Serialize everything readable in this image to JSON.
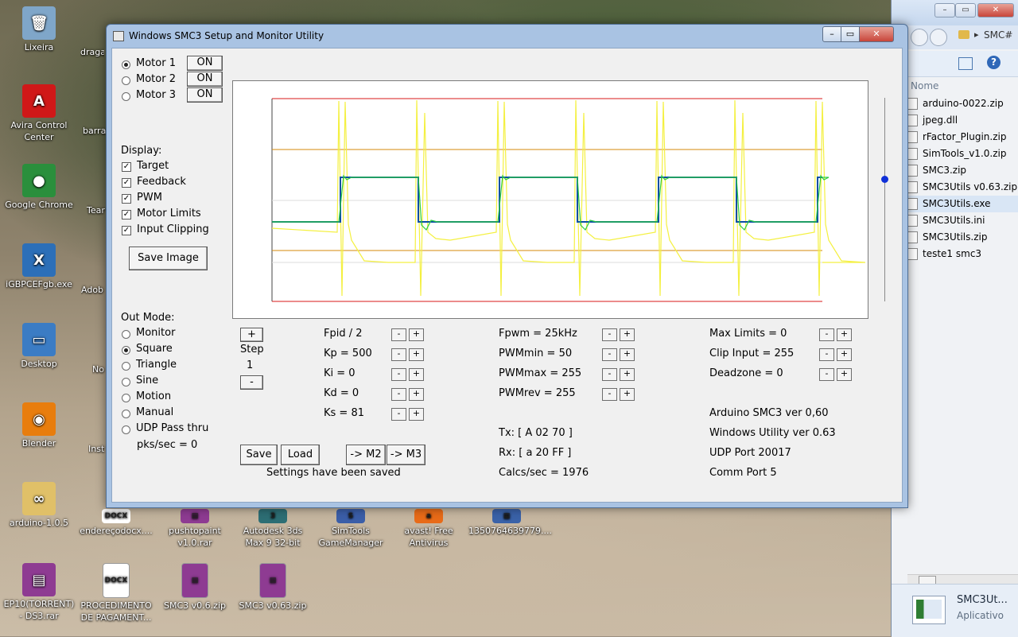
{
  "desktop": {
    "icons": [
      {
        "name": "recycle-bin-icon",
        "label": "Lixeira",
        "color": "#7fa6c9",
        "glyph": "🗑"
      },
      {
        "name": "avira-icon",
        "label": "Avira Control Center",
        "color": "#d01818",
        "glyph": "A"
      },
      {
        "name": "chrome-icon",
        "label": "Google Chrome",
        "color": "#2a8f3c",
        "glyph": "●"
      },
      {
        "name": "exe-icon",
        "label": "iGBPCEFgb.exe",
        "color": "#2c6fb8",
        "glyph": "X"
      },
      {
        "name": "desktop-shortcut-icon",
        "label": "Desktop",
        "color": "#3b7cc4",
        "glyph": "▭"
      },
      {
        "name": "blender-icon",
        "label": "Blender",
        "color": "#e87d0d",
        "glyph": "◉"
      },
      {
        "name": "arduino-folder-icon",
        "label": "arduino-1.0.5",
        "color": "#e0c068",
        "glyph": "∞"
      },
      {
        "name": "winrar-icon",
        "label": "EP10(TORRENT) - DS3.rar",
        "color": "#8e3b92",
        "glyph": "▤"
      }
    ],
    "partial_labels": [
      "draga",
      "barra",
      "Tear",
      "Adob",
      "No",
      "Inst Mo"
    ],
    "bottom_icons": [
      {
        "name": "docx-icon",
        "label": "endereçodocx....",
        "color": "#ffffff",
        "glyph": "DOCX"
      },
      {
        "name": "rar-icon",
        "label": "pushtopaint v1.0.rar",
        "color": "#8e3b92",
        "glyph": "▤"
      },
      {
        "name": "autodesk-icon",
        "label": "Autodesk 3ds Max 9 32-bit",
        "color": "#2d6e74",
        "glyph": "3"
      },
      {
        "name": "simtools-icon",
        "label": "SimTools GameManager",
        "color": "#3b5ea8",
        "glyph": "S"
      },
      {
        "name": "avast-icon",
        "label": "avast! Free Antivirus",
        "color": "#e86b18",
        "glyph": "a"
      },
      {
        "name": "image-icon",
        "label": "1350764639779....",
        "color": "#3a62a8",
        "glyph": "▦"
      }
    ],
    "row3_icons": [
      {
        "name": "docx2-icon",
        "label": "PROCEDIMENTO DE PAGAMENT...",
        "color": "#ffffff",
        "glyph": "DOCX"
      },
      {
        "name": "zip-smc3v06-icon",
        "label": "SMC3 v0.6.zip",
        "color": "#8e3b92",
        "glyph": "▤"
      },
      {
        "name": "zip-smc3v063-icon",
        "label": "SMC3 v0.63.zip",
        "color": "#8e3b92",
        "glyph": "▤"
      }
    ]
  },
  "explorer": {
    "breadcrumb": "SMC#",
    "column_header": "Nome",
    "files": [
      "arduino-0022.zip",
      "jpeg.dll",
      "rFactor_Plugin.zip",
      "SimTools_v1.0.zip",
      "SMC3.zip",
      "SMC3Utils v0.63.zip",
      "SMC3Utils.exe",
      "SMC3Utils.ini",
      "SMC3Utils.zip",
      "teste1 smc3"
    ],
    "selected_file": "SMC3Utils.exe",
    "details_name": "SMC3Ut...",
    "details_type": "Aplicativo"
  },
  "window": {
    "title": "Windows SMC3 Setup and Monitor Utility",
    "motors": [
      {
        "label": "Motor 1",
        "state": "ON",
        "selected": true
      },
      {
        "label": "Motor 2",
        "state": "ON",
        "selected": false
      },
      {
        "label": "Motor 3",
        "state": "ON",
        "selected": false
      }
    ],
    "display_label": "Display:",
    "display_options": [
      "Target",
      "Feedback",
      "PWM",
      "Motor Limits",
      "Input Clipping"
    ],
    "save_image": "Save Image",
    "out_mode_label": "Out Mode:",
    "out_modes": [
      "Monitor",
      "Square",
      "Triangle",
      "Sine",
      "Motion",
      "Manual",
      "UDP Pass thru"
    ],
    "selected_out_mode": "Square",
    "pks_sec": "pks/sec = 0",
    "step_label": "Step",
    "step_value": "1",
    "plus": "+",
    "minus": "-",
    "pid_params": [
      "Fpid / 2",
      "Kp = 500",
      "Ki = 0",
      "Kd = 0",
      "Ks = 81"
    ],
    "pwm_params": [
      "Fpwm = 25kHz",
      "PWMmin = 50",
      "PWMmax = 255",
      "PWMrev = 255"
    ],
    "limit_params": [
      "Max Limits = 0",
      "Clip Input = 255",
      "Deadzone = 0"
    ],
    "save": "Save",
    "load": "Load",
    "to_m2": "-> M2",
    "to_m3": "-> M3",
    "settings_status": "Settings have been saved",
    "tx": "Tx: [ A 02 70 ]",
    "rx": "Rx: [ a 20 FF ]",
    "calcs": "Calcs/sec = 1976",
    "arduino_ver": "Arduino SMC3 ver 0,60",
    "windows_ver": "Windows Utility ver 0.63",
    "udp_port": "UDP Port 20017",
    "comm_port": "Comm Port 5",
    "slider_level": 0.4
  },
  "colors": {
    "target": "#0a4fa3",
    "feedback": "#2ecc40",
    "pwm": "#f4f040",
    "motor_limits": "#d81818",
    "input_clipping": "#d48a0a",
    "slider": "#1030d8"
  }
}
